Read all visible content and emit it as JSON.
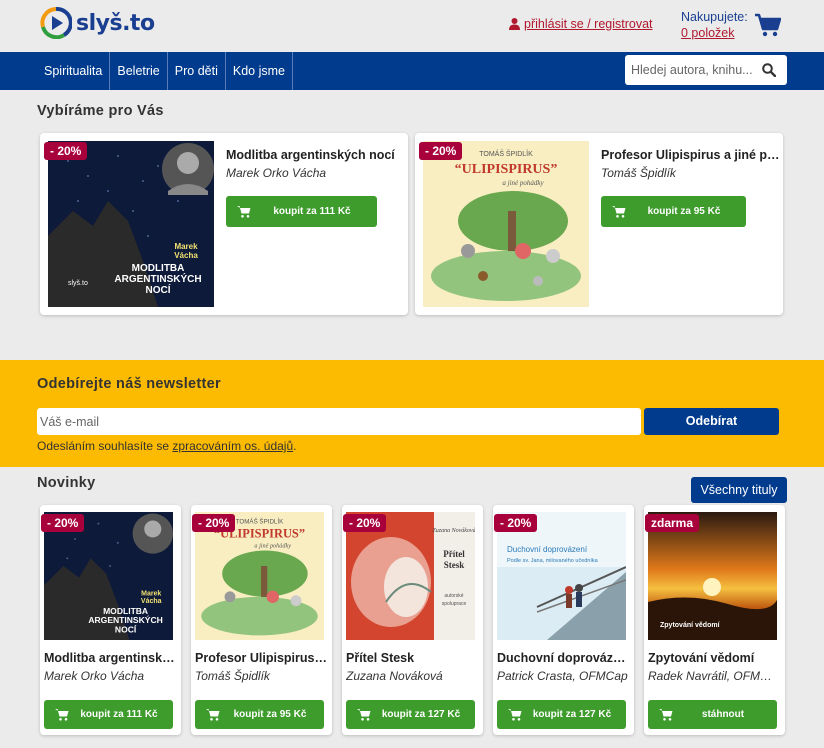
{
  "header": {
    "logo_text": "slyš.to",
    "login_label": "přihlásit se / registrovat",
    "cart_label": "Nakupujete:",
    "cart_count": "0 položek"
  },
  "nav": {
    "items": [
      "Spiritualita",
      "Beletrie",
      "Pro děti",
      "Kdo jsme"
    ],
    "search_placeholder": "Hledej autora, knihu..."
  },
  "featured": {
    "title": "Vybíráme pro Vás",
    "items": [
      {
        "title": "Modlitba argentinských nocí",
        "author": "Marek Orko Vácha",
        "badge": "- 20%",
        "button": "koupit za 111 Kč",
        "cover_text": "MODLITBA ARGENTINSKÝCH NOCÍ",
        "cover_author": "Marek Vácha"
      },
      {
        "title": "Profesor Ulipispirus a jiné pohádky",
        "author": "Tomáš Špidlík",
        "badge": "- 20%",
        "button": "koupit za 95 Kč",
        "cover_text": "ULIPISPIRUS",
        "cover_author": "TOMÁŠ ŠPIDLÍK"
      }
    ]
  },
  "newsletter": {
    "title": "Odebírejte náš newsletter",
    "email_placeholder": "Váš e-mail",
    "subscribe_label": "Odebírat",
    "consent_prefix": "Odesláním souhlasíte se ",
    "consent_link": "zpracováním os. údajů",
    "consent_suffix": "."
  },
  "news": {
    "title": "Novinky",
    "all_titles": "Všechny tituly",
    "items": [
      {
        "title": "Modlitba argentinských nocí",
        "author": "Marek Orko Vácha",
        "badge": "- 20%",
        "button": "koupit za 111 Kč"
      },
      {
        "title": "Profesor Ulipispirus a jiné pohádky",
        "author": "Tomáš Špidlík",
        "badge": "- 20%",
        "button": "koupit za 95 Kč"
      },
      {
        "title": "Přítel Stesk",
        "author": "Zuzana Nováková",
        "badge": "- 20%",
        "button": "koupit za 127 Kč"
      },
      {
        "title": "Duchovní doprovázení",
        "author": "Patrick Crasta, OFMCap",
        "badge": "- 20%",
        "button": "koupit za 127 Kč"
      },
      {
        "title": "Zpytování vědomí",
        "author": "Radek Navrátil, OFMCap",
        "badge": "zdarma",
        "button": "stáhnout"
      }
    ]
  },
  "colors": {
    "brand_blue": "#003b8e",
    "accent_yellow": "#fcbb00",
    "buy_green": "#3d9c2c",
    "badge_red": "#a8003a",
    "login_red": "#b0182e"
  }
}
